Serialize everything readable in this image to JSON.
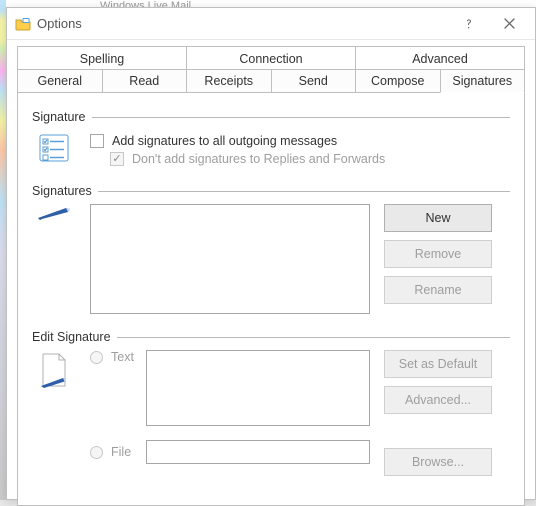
{
  "backdrop_title": "Windows Live Mail",
  "window": {
    "title": "Options"
  },
  "tabs": {
    "row1": [
      "Spelling",
      "Connection",
      "Advanced"
    ],
    "row2": [
      "General",
      "Read",
      "Receipts",
      "Send",
      "Compose",
      "Signatures"
    ],
    "active": "Signatures"
  },
  "groups": {
    "signature": "Signature",
    "signatures": "Signatures",
    "edit": "Edit Signature"
  },
  "checkboxes": {
    "add_all": "Add signatures to all outgoing messages",
    "skip_replies": "Don't add signatures to Replies and Forwards"
  },
  "buttons": {
    "new": "New",
    "remove": "Remove",
    "rename": "Rename",
    "set_default": "Set as Default",
    "advanced": "Advanced...",
    "browse": "Browse..."
  },
  "radios": {
    "text": "Text",
    "file": "File"
  }
}
